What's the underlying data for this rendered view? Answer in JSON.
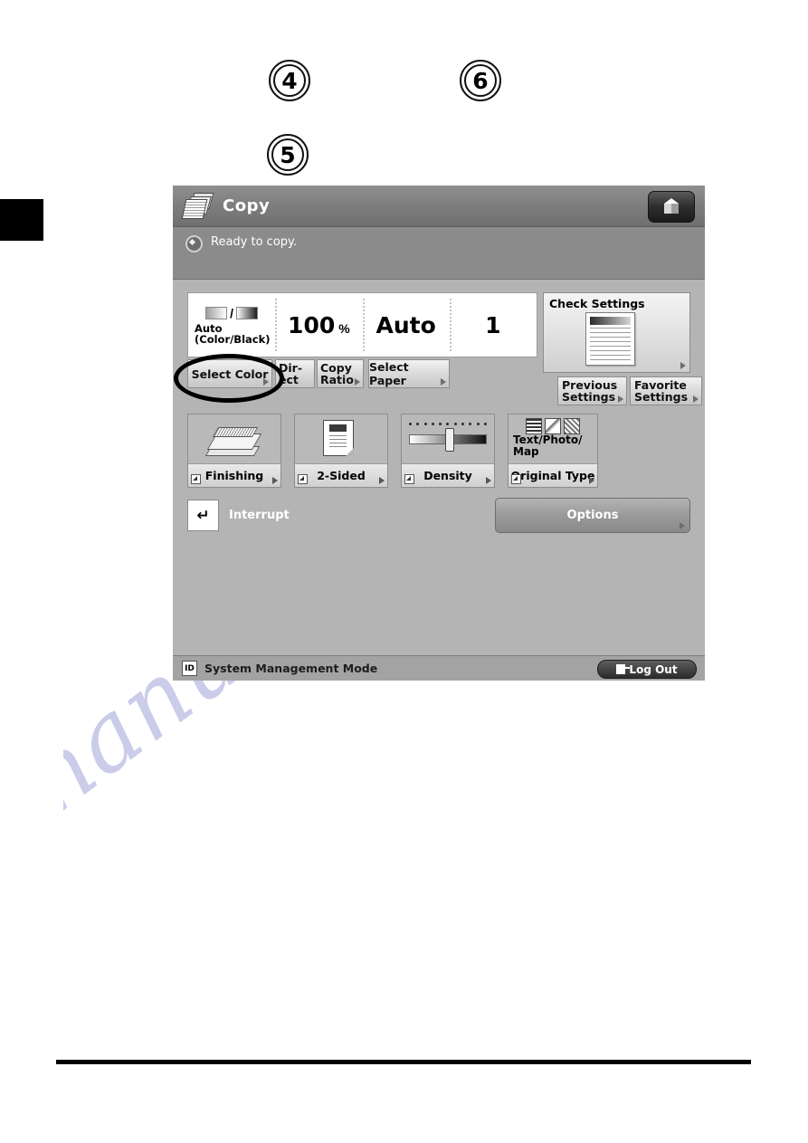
{
  "callouts": [
    {
      "number": "4"
    },
    {
      "number": "5"
    },
    {
      "number": "6"
    }
  ],
  "watermark": {
    "text": "manualshive.com"
  },
  "panel": {
    "header": {
      "title": "Copy",
      "copy_icon": "copy-documents-icon",
      "cube_button_icon": "3d-cube-icon"
    },
    "status": {
      "icon": "status-ready-icon",
      "message": "Ready to copy."
    },
    "settings_row": {
      "color_mode": {
        "swatch_left": "color-gradient-swatch",
        "separator": "/",
        "swatch_right": "black-gradient-swatch",
        "line1": "Auto",
        "line2": "(Color/Black)"
      },
      "copy_ratio": {
        "value": "100",
        "unit": "%"
      },
      "paper": {
        "value": "Auto"
      },
      "copies": {
        "value": "1"
      }
    },
    "quick_buttons": {
      "select_color": "Select Color",
      "direct_line1": "Dir-",
      "direct_line2": "ect",
      "copy_ratio_line1": "Copy",
      "copy_ratio_line2": "Ratio",
      "select_paper": "Select Paper"
    },
    "check_settings": {
      "label": "Check Settings",
      "preview_icon": "document-preview-icon",
      "previous_line1": "Previous",
      "previous_line2": "Settings",
      "favorite_line1": "Favorite",
      "favorite_line2": "Settings"
    },
    "function_buttons": [
      {
        "caption": "Finishing",
        "icon": "finisher-icon"
      },
      {
        "caption": "2-Sided",
        "icon": "two-sided-sheet-icon"
      },
      {
        "caption": "Density",
        "icon": "density-slider-icon"
      },
      {
        "caption": "Original Type",
        "icon": "original-type-icon",
        "value_line1": "Text/Photo/",
        "value_line2": "Map"
      }
    ],
    "interrupt": {
      "label": "Interrupt",
      "icon": "interrupt-icon",
      "glyph": "↵"
    },
    "options": {
      "label": "Options"
    },
    "footer": {
      "id_badge": "ID",
      "mode": "System Management Mode",
      "logout": "Log Out",
      "logout_icon": "logout-door-icon"
    }
  }
}
